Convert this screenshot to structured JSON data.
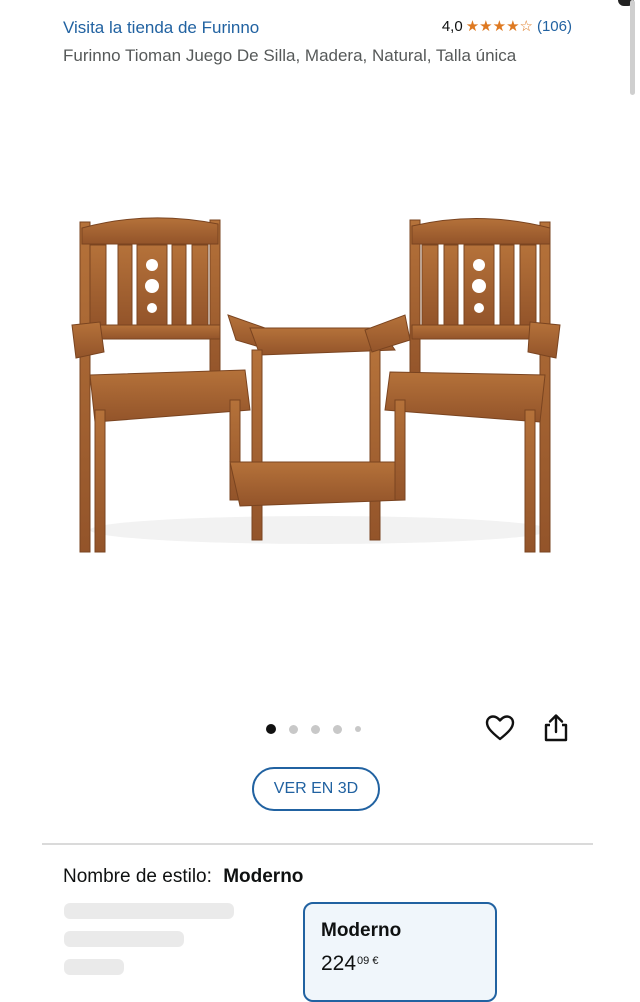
{
  "store": {
    "link_text": "Visita la tienda de Furinno"
  },
  "rating": {
    "value": "4,0",
    "stars": 4,
    "max": 5,
    "count": "(106)"
  },
  "product": {
    "title": "Furinno Tioman Juego De Silla, Madera, Natural, Talla única"
  },
  "image": {
    "dots": 5,
    "active_index": 0
  },
  "actions": {
    "view_3d": "VER EN 3D"
  },
  "style": {
    "label": "Nombre de estilo:",
    "selected": "Moderno"
  },
  "option": {
    "name": "Moderno",
    "price_whole": "224",
    "price_cents": "09 €"
  },
  "colors": {
    "link": "#2162a1",
    "star": "#de7921",
    "wood": "#a8642e"
  }
}
